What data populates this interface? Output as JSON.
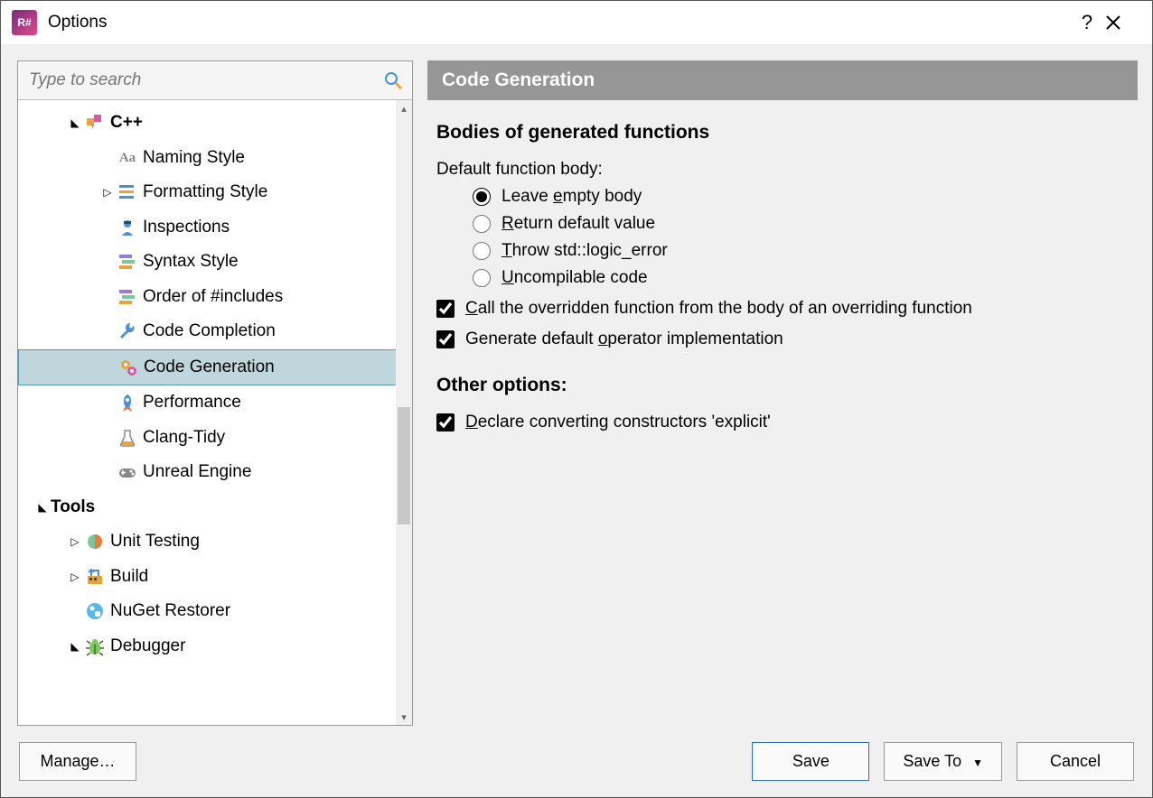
{
  "window": {
    "title": "Options"
  },
  "search": {
    "placeholder": "Type to search"
  },
  "tree": {
    "items": [
      {
        "label": "C++",
        "level": 1,
        "arrow": "down",
        "bold": true,
        "icon": "cpp"
      },
      {
        "label": "Naming Style",
        "level": 2,
        "arrow": "",
        "icon": "aa"
      },
      {
        "label": "Formatting Style",
        "level": 2,
        "arrow": "right",
        "icon": "formatting"
      },
      {
        "label": "Inspections",
        "level": 2,
        "arrow": "",
        "icon": "inspector"
      },
      {
        "label": "Syntax Style",
        "level": 2,
        "arrow": "",
        "icon": "syntax"
      },
      {
        "label": "Order of #includes",
        "level": 2,
        "arrow": "",
        "icon": "syntax"
      },
      {
        "label": "Code Completion",
        "level": 2,
        "arrow": "",
        "icon": "wrench"
      },
      {
        "label": "Code Generation",
        "level": 2,
        "arrow": "",
        "icon": "gears",
        "selected": true
      },
      {
        "label": "Performance",
        "level": 2,
        "arrow": "",
        "icon": "rocket"
      },
      {
        "label": "Clang-Tidy",
        "level": 2,
        "arrow": "",
        "icon": "flask"
      },
      {
        "label": "Unreal Engine",
        "level": 2,
        "arrow": "",
        "icon": "gamepad"
      },
      {
        "label": "Tools",
        "level": 0,
        "arrow": "down",
        "bold": true,
        "icon": ""
      },
      {
        "label": "Unit Testing",
        "level": 1,
        "arrow": "right",
        "icon": "circle"
      },
      {
        "label": "Build",
        "level": 1,
        "arrow": "right",
        "icon": "build"
      },
      {
        "label": "NuGet Restorer",
        "level": 1,
        "arrow": "",
        "icon": "nuget"
      },
      {
        "label": "Debugger",
        "level": 1,
        "arrow": "down",
        "icon": "bug"
      }
    ]
  },
  "main": {
    "header": "Code Generation",
    "section1_title": "Bodies of generated functions",
    "default_body_label": "Default function body:",
    "radios": [
      {
        "pre": "Leave ",
        "u": "e",
        "post": "mpty body",
        "checked": true
      },
      {
        "pre": "",
        "u": "R",
        "post": "eturn default value",
        "checked": false
      },
      {
        "pre": "",
        "u": "T",
        "post": "hrow std::logic_error",
        "checked": false
      },
      {
        "pre": "",
        "u": "U",
        "post": "ncompilable code",
        "checked": false
      }
    ],
    "check1": {
      "pre": "",
      "u": "C",
      "post": "all the overridden function from the body of an overriding function",
      "checked": true
    },
    "check2": {
      "pre": "Generate default ",
      "u": "o",
      "post": "perator implementation",
      "checked": true
    },
    "section2_title": "Other options:",
    "check3": {
      "pre": "",
      "u": "D",
      "post": "eclare converting constructors 'explicit'",
      "checked": true
    }
  },
  "footer": {
    "manage": "Manage…",
    "save": "Save",
    "saveto": "Save To",
    "cancel": "Cancel"
  }
}
